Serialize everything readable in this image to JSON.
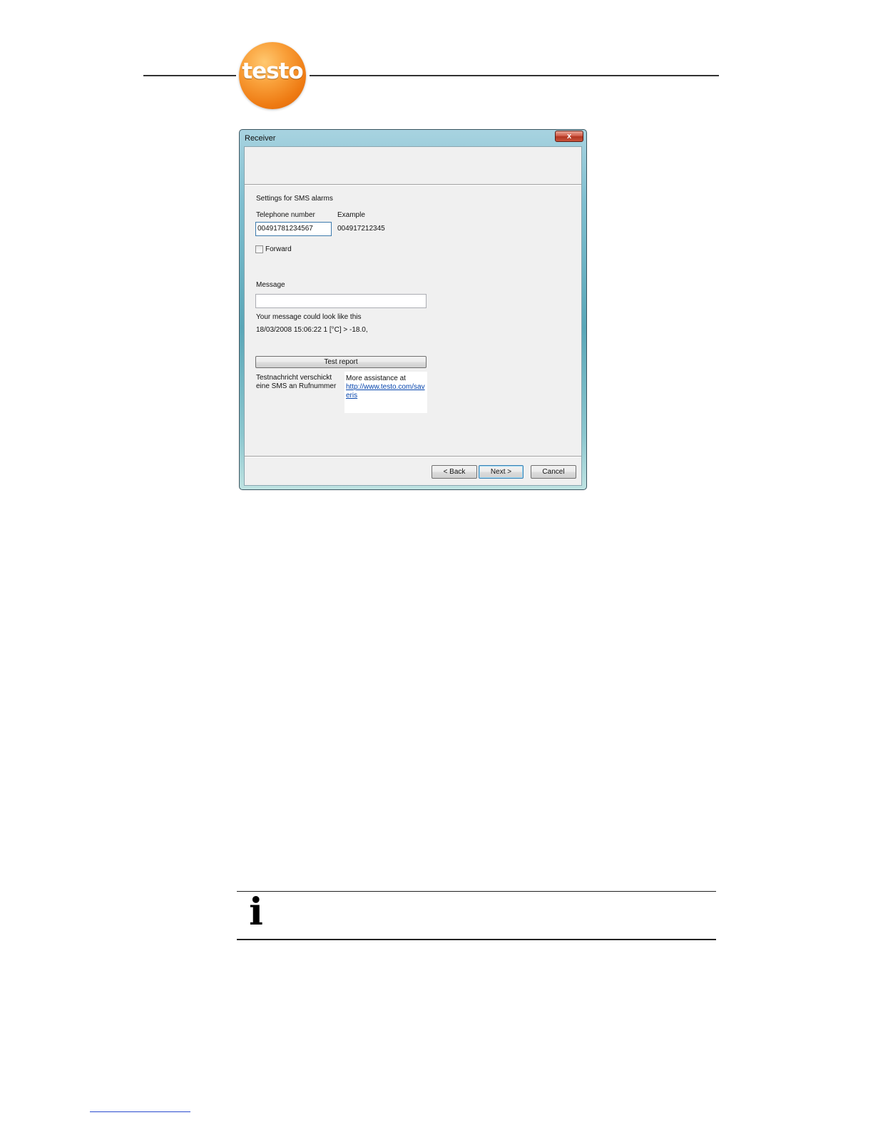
{
  "logo": {
    "text": "testo"
  },
  "window": {
    "title": "Receiver",
    "close_label": "x"
  },
  "form": {
    "section_title": "Settings for SMS alarms",
    "telephone_label": "Telephone number",
    "telephone_value": "00491781234567",
    "example_label": "Example",
    "example_value": "004917212345",
    "forward_label": "Forward",
    "forward_checked": false,
    "message_label": "Message",
    "message_value": "",
    "preview_label": "Your message could look like this",
    "preview_value": "18/03/2008 15:06:22 1 [°C] > -18.0,",
    "test_button_label": "Test report",
    "test_note_line1": "Testnachricht verschickt",
    "test_note_line2": "eine SMS an Rufnummer",
    "help_text": "More assistance at",
    "help_link": "http://www.testo.com/saveris"
  },
  "buttons": {
    "back": "< Back",
    "next": "Next >",
    "cancel": "Cancel"
  },
  "info": {
    "icon": "i"
  }
}
